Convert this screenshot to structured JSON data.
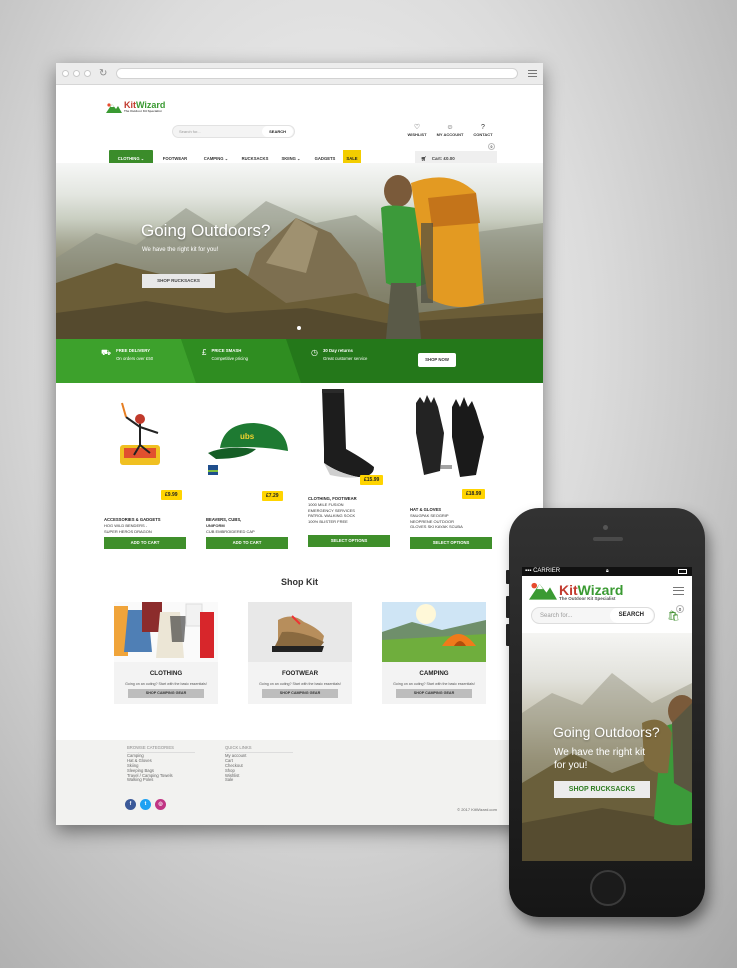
{
  "desktop": {
    "header": {
      "logo_name_kit": "Kit",
      "logo_name_wizard": "Wizard",
      "logo_tagline": "The Outdoor Kit Specialist",
      "search_placeholder": "Search for...",
      "search_button": "SEARCH",
      "icons": [
        {
          "label": "WISHLIST",
          "icon": "heart-icon",
          "glyph": "♡"
        },
        {
          "label": "MY ACCOUNT",
          "icon": "user-icon",
          "glyph": "☺"
        },
        {
          "label": "CONTACT",
          "icon": "question-icon",
          "glyph": "?"
        }
      ],
      "cart_text": "Cart: £0.00",
      "cart_count": "0"
    },
    "nav": [
      {
        "label": "CLOTHING ⌄"
      },
      {
        "label": "FOOTWEAR"
      },
      {
        "label": "CAMPING ⌄"
      },
      {
        "label": "RUCKSACKS"
      },
      {
        "label": "SKIING ⌄"
      },
      {
        "label": "GADGETS"
      },
      {
        "label": "SALE"
      }
    ],
    "hero": {
      "title": "Going Outdoors?",
      "subtitle": "We have the right kit for you!",
      "button": "SHOP RUCKSACKS"
    },
    "benefits": [
      {
        "icon": "truck-icon",
        "glyph": "⛟",
        "title": "FREE DELIVERY",
        "sub": "On orders over £50"
      },
      {
        "icon": "price-tag-icon",
        "glyph": "£",
        "title": "PRICE SMASH",
        "sub": "Competitive pricing"
      },
      {
        "icon": "clock-icon",
        "glyph": "◷",
        "title": "30 Day returns",
        "sub": "Great customer service"
      }
    ],
    "benefits_button": "SHOP NOW",
    "products": [
      {
        "price": "£9.99",
        "category": "ACCESSORIES & GADGETS",
        "lines": [
          "HOG WILD BENDERS -",
          "SUPER HEROS DRAGON"
        ],
        "button": "ADD TO CART"
      },
      {
        "price": "£7.29",
        "category": "BEAVERS,  CUBS,",
        "lines": [
          "UNIFORM",
          "CUB EMBROIDERED CAP"
        ],
        "button": "ADD TO CART"
      },
      {
        "price": "£15.99",
        "category": "CLOTHING,  FOOTWEAR",
        "lines": [
          "1000 MILE FUSION",
          "EMERGENCY SERVICES",
          "PATROL WALKING SOCK",
          "100% BLISTER FREE"
        ],
        "button": "SELECT OPTIONS"
      },
      {
        "price": "£18.99",
        "category": "HAT & GLOVES",
        "lines": [
          "SNUGPAK SEOGRIP",
          "NEOPRENE OUTDOOR",
          "GLOVES SKI KAYAK SCUBA"
        ],
        "button": "SELECT OPTIONS"
      }
    ],
    "shop_kit_title": "Shop Kit",
    "kits": [
      {
        "title": "CLOTHING",
        "sub": "Going on an outing? Start with the basic essentials!",
        "button": "SHOP CAMPING GEAR"
      },
      {
        "title": "FOOTWEAR",
        "sub": "Going on an outing? Start with the basic essentials!",
        "button": "SHOP CAMPING GEAR"
      },
      {
        "title": "CAMPING",
        "sub": "Going on an outing? Start with the basic essentials!",
        "button": "SHOP CAMPING GEAR"
      }
    ],
    "footer": {
      "browse_heading": "BROWSE CATEGORIES",
      "browse_items": [
        "Camping",
        "Hat & Gloves",
        "Skiing",
        "Sleeping Bags",
        "Travel / Camping Towels",
        "Walking Poles"
      ],
      "quick_heading": "QUICK LINKS",
      "quick_items": [
        "My account",
        "Cart",
        "Checkout",
        "Shop",
        "Wishlist",
        "Sale"
      ],
      "social": [
        {
          "icon": "facebook-icon",
          "glyph": "f",
          "color": "#3b5998"
        },
        {
          "icon": "twitter-icon",
          "glyph": "t",
          "color": "#1da1f2"
        },
        {
          "icon": "instagram-icon",
          "glyph": "◎",
          "color": "#c13584"
        }
      ],
      "copyright": "© 2017 KitWizard.com"
    }
  },
  "mobile": {
    "carrier": "CARRIER",
    "logo_name_kit": "Kit",
    "logo_name_wizard": "Wizard",
    "logo_tagline": "The Outdoor Kit Specialist",
    "search_placeholder": "Search for...",
    "search_button": "SEARCH",
    "cart_count": "0",
    "hero_title": "Going Outdoors?",
    "hero_sub": "We have the right kit for you!",
    "hero_button": "SHOP RUCKSACKS"
  },
  "colors": {
    "brand_green": "#3b8c2a",
    "brand_red": "#c23a2e",
    "sale_yellow": "#f3cd00",
    "price_yellow": "#ffd400"
  }
}
